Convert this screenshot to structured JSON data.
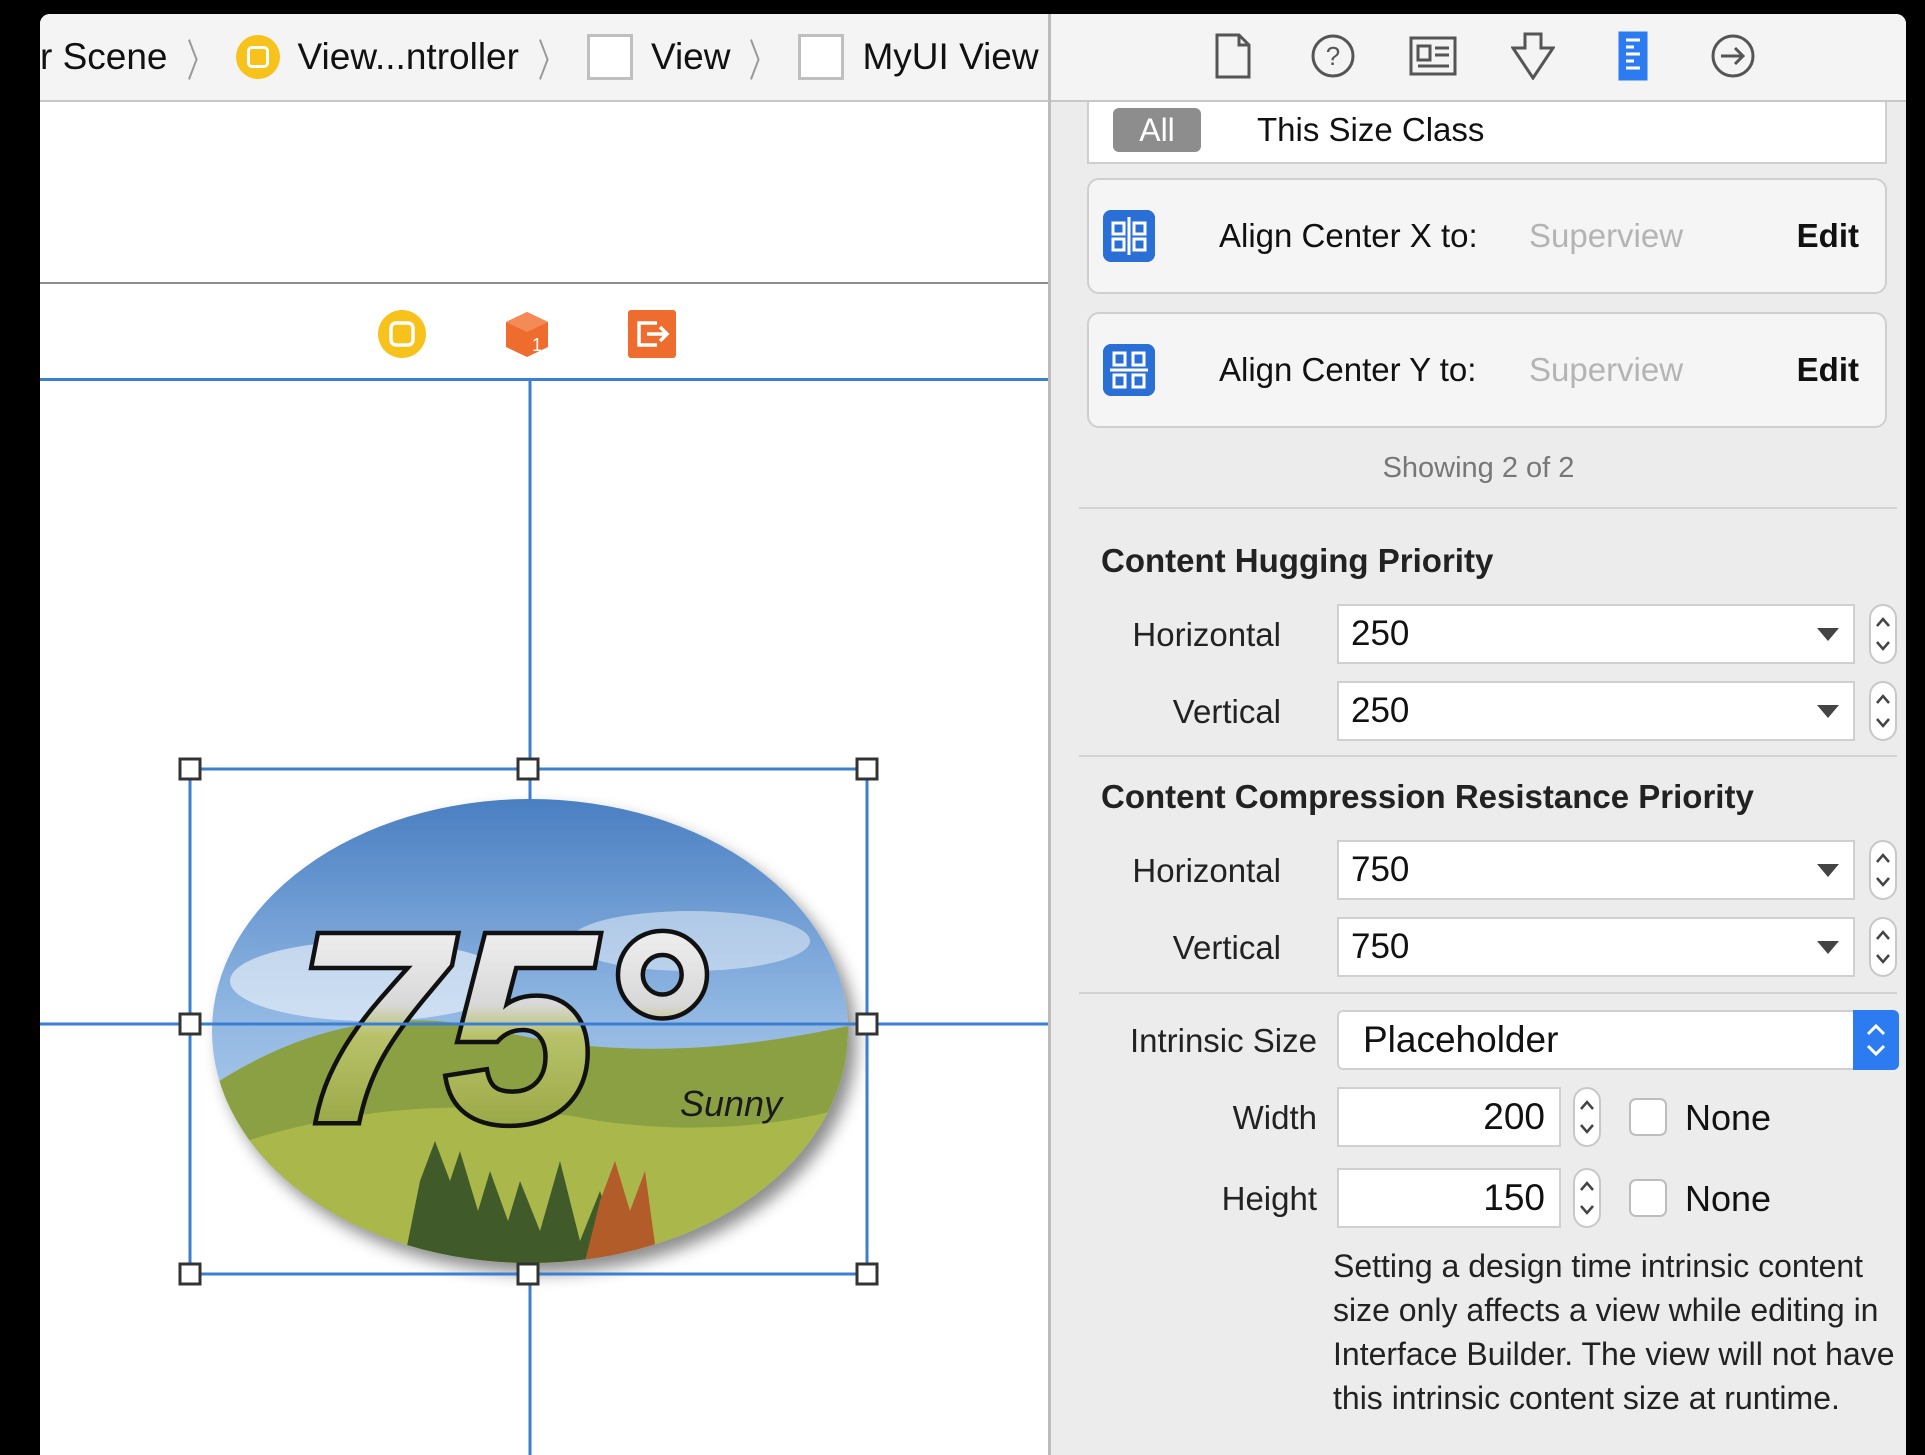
{
  "breadcrumb": {
    "scene": "r Scene",
    "controller": "View...ntroller",
    "view": "View",
    "myui": "MyUI View"
  },
  "canvas": {
    "temperature": "75°",
    "condition": "Sunny"
  },
  "inspector_tabs": [
    "file-icon",
    "help-icon",
    "identity-icon",
    "attributes-icon",
    "size-ruler-icon",
    "connections-icon"
  ],
  "size_class": {
    "all": "All",
    "this": "This Size Class"
  },
  "constraints": [
    {
      "label": "Align Center X to:",
      "value": "Superview",
      "edit": "Edit"
    },
    {
      "label": "Align Center Y to:",
      "value": "Superview",
      "edit": "Edit"
    }
  ],
  "showing": "Showing 2 of 2",
  "hugging": {
    "title": "Content Hugging Priority",
    "horizontal_label": "Horizontal",
    "horizontal": "250",
    "vertical_label": "Vertical",
    "vertical": "250"
  },
  "compression": {
    "title": "Content Compression Resistance Priority",
    "horizontal_label": "Horizontal",
    "horizontal": "750",
    "vertical_label": "Vertical",
    "vertical": "750"
  },
  "intrinsic": {
    "label": "Intrinsic Size",
    "value": "Placeholder",
    "width_label": "Width",
    "width": "200",
    "height_label": "Height",
    "height": "150",
    "none_label": "None",
    "note": "Setting a design time intrinsic content size only affects a view while editing in Interface Builder. The view will not have this intrinsic content size at runtime."
  },
  "colors": {
    "accent": "#2d7bf0",
    "guide": "#3c7fd0",
    "scene_yellow": "#f7c21c",
    "scene_orange": "#ef6c2f"
  }
}
